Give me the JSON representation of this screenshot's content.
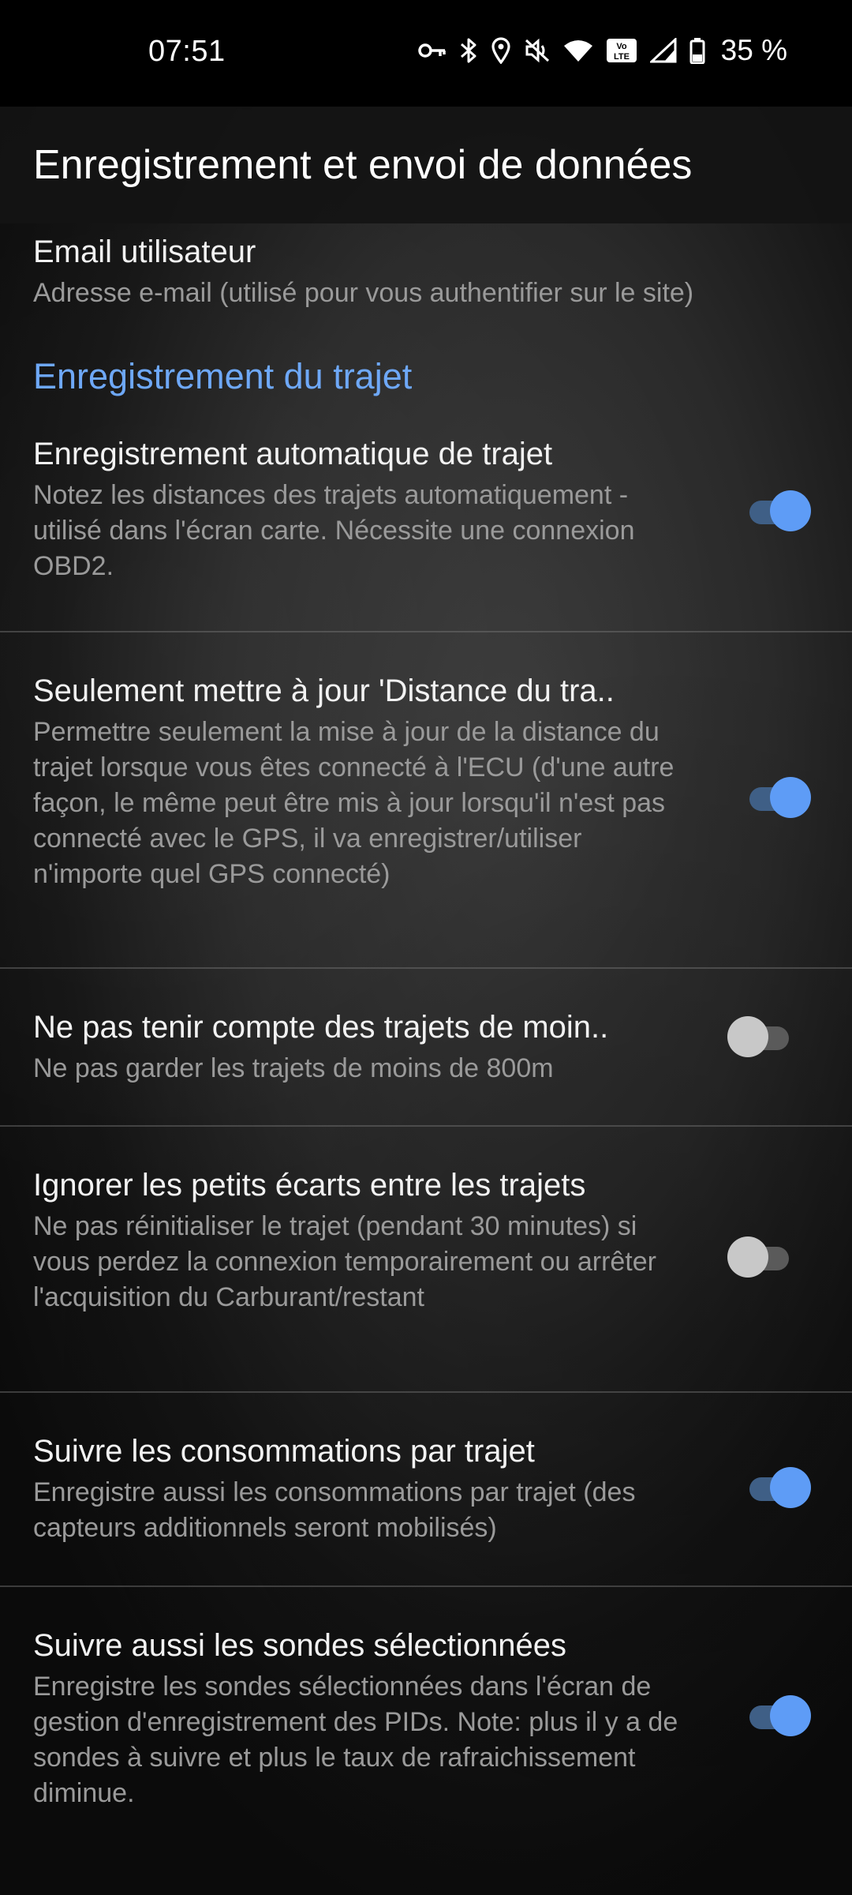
{
  "status_bar": {
    "time": "07:51",
    "battery": "35 %",
    "icons": [
      "key-icon",
      "bluetooth-icon",
      "location-icon",
      "mute-icon",
      "wifi-icon",
      "volte-icon",
      "signal-icon",
      "battery-icon"
    ]
  },
  "app_bar": {
    "title": "Enregistrement et envoi de données"
  },
  "email_pref": {
    "title": "Email utilisateur",
    "summary": "Adresse e-mail (utilisé pour vous authentifier sur le site)"
  },
  "category": {
    "title": "Enregistrement du trajet"
  },
  "preferences": [
    {
      "title": "Enregistrement automatique de trajet",
      "summary": "Notez les distances des trajets automatiquement - utilisé dans l'écran carte. Nécessite une connexion OBD2.",
      "enabled": true
    },
    {
      "title": "Seulement mettre à jour 'Distance du tra..",
      "summary": "Permettre seulement la mise à jour de la distance du trajet lorsque vous êtes connecté à l'ECU (d'une autre façon, le même peut être mis à jour lorsqu'il n'est pas connecté avec le GPS, il va enregistrer/utiliser n'importe quel GPS connecté)",
      "enabled": true
    },
    {
      "title": "Ne pas tenir compte des trajets de moin..",
      "summary": "Ne pas garder les trajets de moins de 800m",
      "enabled": false
    },
    {
      "title": "Ignorer les petits écarts entre les trajets",
      "summary": "Ne pas réinitialiser le trajet (pendant 30 minutes) si vous perdez la connexion temporairement ou arrêter l'acquisition du Carburant/restant",
      "enabled": false
    },
    {
      "title": "Suivre les consommations par trajet",
      "summary": "Enregistre aussi les consommations par trajet (des capteurs additionnels seront mobilisés)",
      "enabled": true
    },
    {
      "title": "Suivre aussi les sondes sélectionnées",
      "summary": "Enregistre les sondes sélectionnées dans l'écran de gestion d'enregistrement des PIDs. Note: plus il y a de sondes à suivre et plus le taux de rafraichissement diminue.",
      "enabled": true
    }
  ],
  "colors": {
    "accent": "#5e9cf6",
    "category": "#6ea8f7",
    "summary": "#9a9a9a"
  }
}
